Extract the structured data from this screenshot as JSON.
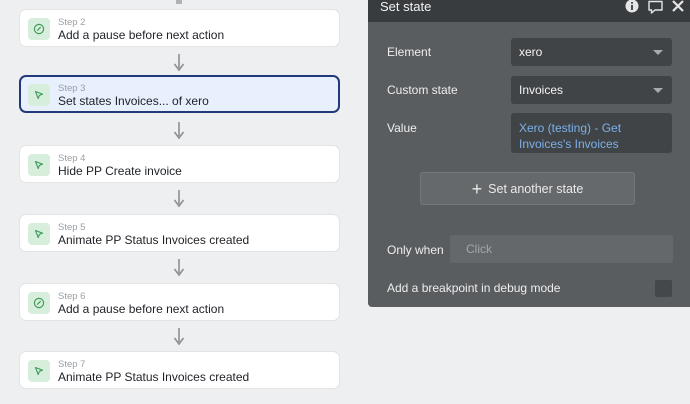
{
  "workflow": {
    "steps": [
      {
        "label": "Step 2",
        "title": "Add a pause before next action",
        "icon": "pause-clock-icon"
      },
      {
        "label": "Step 3",
        "title": "Set states Invoices... of xero",
        "icon": "cursor-arrow-icon",
        "selected": true
      },
      {
        "label": "Step 4",
        "title": "Hide PP Create invoice",
        "icon": "cursor-arrow-icon"
      },
      {
        "label": "Step 5",
        "title": "Animate PP Status Invoices created",
        "icon": "cursor-arrow-icon"
      },
      {
        "label": "Step 6",
        "title": "Add a pause before next action",
        "icon": "pause-clock-icon"
      },
      {
        "label": "Step 7",
        "title": "Animate PP Status Invoices created",
        "icon": "cursor-arrow-icon"
      }
    ]
  },
  "panel": {
    "title": "Set state",
    "header_icons": [
      "info-icon",
      "comment-icon",
      "close-icon"
    ],
    "element_label": "Element",
    "element_value": "xero",
    "custom_state_label": "Custom state",
    "custom_state_value": "Invoices",
    "value_label": "Value",
    "value_expression": "Xero (testing) - Get Invoices's Invoices",
    "add_button": "Set another state",
    "only_when_label": "Only when",
    "only_when_placeholder": "Click",
    "breakpoint_label": "Add a breakpoint in debug mode"
  },
  "colors": {
    "selected_border": "#233a7a",
    "selected_bg": "#e8f0fd",
    "icon_bg": "#d8eedd",
    "icon_green": "#3f9c58",
    "panel_bg": "#5a5d60",
    "expression_blue": "#7bb0ea"
  }
}
